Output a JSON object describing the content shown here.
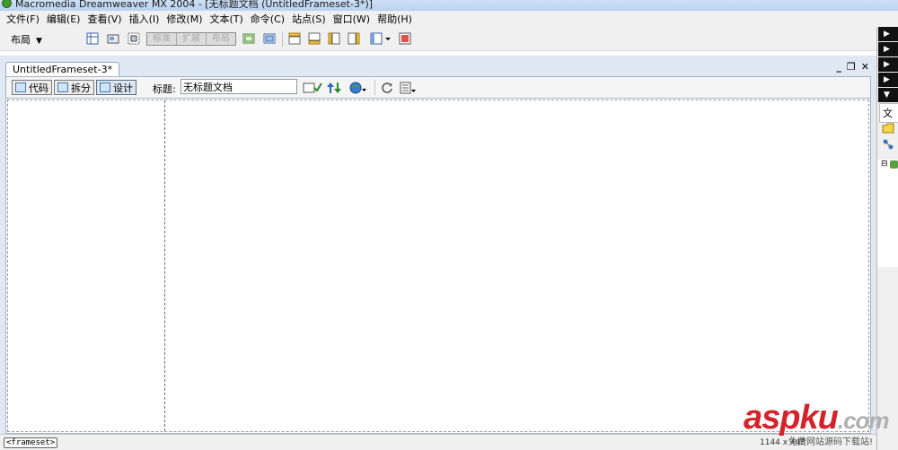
{
  "window": {
    "title": "Macromedia Dreamweaver MX 2004 - [无标题文档 (UntitledFrameset-3*)]"
  },
  "menu": {
    "items": [
      "文件(F)",
      "编辑(E)",
      "查看(V)",
      "插入(I)",
      "修改(M)",
      "文本(T)",
      "命令(C)",
      "站点(S)",
      "窗口(W)",
      "帮助(H)"
    ]
  },
  "toolbar": {
    "layout_dropdown": "布局",
    "modes": [
      "标准",
      "扩展",
      "布局"
    ]
  },
  "document": {
    "tab_label": "UntitledFrameset-3*",
    "view_buttons": {
      "code": "代码",
      "split": "拆分",
      "design": "设计"
    },
    "title_label": "标题:",
    "title_value": "无标题文档"
  },
  "status": {
    "tag": "<frameset>",
    "size": "1144 x 448"
  },
  "right_panel": {
    "tab_label": "文"
  },
  "watermark": {
    "logo_main": "asp",
    "logo_rest": "ku",
    "logo_tld": ".com",
    "subtitle": "免费网站源码下载站!"
  },
  "colors": {
    "accent": "#3f9a2d",
    "watermark_red": "#d4232b"
  }
}
